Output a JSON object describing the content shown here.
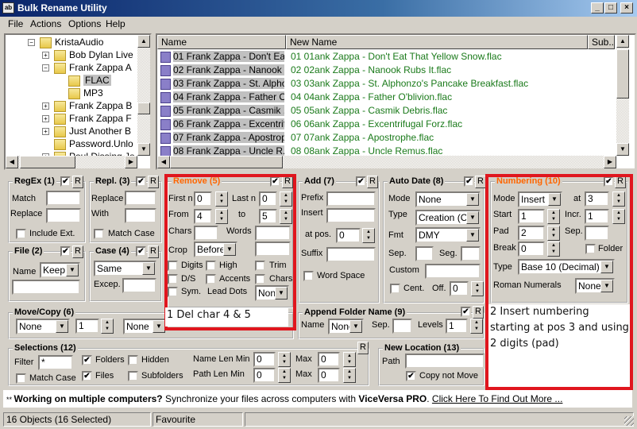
{
  "window": {
    "title": "Bulk Rename Utility",
    "icon": "app-icon"
  },
  "menu": [
    "File",
    "Actions",
    "Options",
    "Help"
  ],
  "tree": [
    {
      "label": "KristaAudio",
      "expander": "−",
      "indent": 0
    },
    {
      "label": "Bob Dylan Live",
      "expander": "+",
      "indent": 1
    },
    {
      "label": "Frank Zappa A",
      "expander": "−",
      "indent": 1
    },
    {
      "label": "FLAC",
      "expander": "",
      "indent": 2,
      "selected": true
    },
    {
      "label": "MP3",
      "expander": "",
      "indent": 2
    },
    {
      "label": "Frank Zappa B",
      "expander": "+",
      "indent": 1
    },
    {
      "label": "Frank Zappa F",
      "expander": "+",
      "indent": 1
    },
    {
      "label": "Just Another B",
      "expander": "+",
      "indent": 1
    },
    {
      "label": "Password.Unlo",
      "expander": "",
      "indent": 1
    },
    {
      "label": "Poul Dissing Jo",
      "expander": "+",
      "indent": 1
    }
  ],
  "filelist": {
    "columns": {
      "name": "Name",
      "new_name": "New Name",
      "sub": "Sub.."
    },
    "rows": [
      {
        "name": "01 Frank Zappa - Don't Eat...",
        "new_name": "01 01ank Zappa - Don't Eat That Yellow Snow.flac"
      },
      {
        "name": "02 Frank Zappa - Nanook ...",
        "new_name": "02 02ank Zappa - Nanook Rubs It.flac"
      },
      {
        "name": "03 Frank Zappa - St. Alpho...",
        "new_name": "03 03ank Zappa - St. Alphonzo's Pancake Breakfast.flac"
      },
      {
        "name": "04 Frank Zappa - Father O'...",
        "new_name": "04 04ank Zappa - Father O'blivion.flac"
      },
      {
        "name": "05 Frank Zappa - Casmik ...",
        "new_name": "05 05ank Zappa - Casmik Debris.flac"
      },
      {
        "name": "06 Frank Zappa - Excentrif...",
        "new_name": "06 06ank Zappa - Excentrifugal Forz.flac"
      },
      {
        "name": "07 Frank Zappa - Apostrop...",
        "new_name": "07 07ank Zappa - Apostrophe.flac"
      },
      {
        "name": "08 Frank Zappa - Uncle R...",
        "new_name": "08 08ank Zappa - Uncle Remus.flac"
      }
    ],
    "new_name_color": "#1a7a1a"
  },
  "regex": {
    "title": "RegEx (1)",
    "match": "Match",
    "replace": "Replace",
    "include_ext": "Include Ext.",
    "r": "R"
  },
  "repl": {
    "title": "Repl. (3)",
    "replace": "Replace",
    "with": "With",
    "match_case": "Match Case",
    "r": "R"
  },
  "remove": {
    "title": "Remove (5)",
    "title_color": "#ff6600",
    "first_n": "First n",
    "first_n_val": "0",
    "last_n": "Last n",
    "last_n_val": "0",
    "from": "From",
    "from_val": "4",
    "to": "to",
    "to_val": "5",
    "chars": "Chars",
    "words": "Words",
    "crop": "Crop",
    "crop_val": "Before",
    "digits": "Digits",
    "high": "High",
    "trim": "Trim",
    "ds": "D/S",
    "accents": "Accents",
    "chars2": "Chars",
    "sym": "Sym.",
    "lead_dots": "Lead Dots",
    "lead_dots_val": "None",
    "r": "R"
  },
  "file": {
    "title": "File (2)",
    "name": "Name",
    "name_val": "Keep",
    "r": "R"
  },
  "case": {
    "title": "Case (4)",
    "case_val": "Same",
    "excep": "Excep.",
    "r": "R"
  },
  "add": {
    "title": "Add (7)",
    "prefix": "Prefix",
    "insert": "Insert",
    "at_pos": "at pos.",
    "at_pos_val": "0",
    "suffix": "Suffix",
    "word_space": "Word Space",
    "r": "R"
  },
  "autodate": {
    "title": "Auto Date (8)",
    "mode": "Mode",
    "mode_val": "None",
    "type": "Type",
    "type_val": "Creation (Curr",
    "fmt": "Fmt",
    "fmt_val": "DMY",
    "sep": "Sep.",
    "seg": "Seg.",
    "custom": "Custom",
    "cent": "Cent.",
    "off": "Off.",
    "off_val": "0",
    "r": "R"
  },
  "numbering": {
    "title": "Numbering (10)",
    "title_color": "#ff6600",
    "mode": "Mode",
    "mode_val": "Insert",
    "at": "at",
    "at_val": "3",
    "start": "Start",
    "start_val": "1",
    "incr": "Incr.",
    "incr_val": "1",
    "pad": "Pad",
    "pad_val": "2",
    "sep": "Sep.",
    "brk": "Break",
    "break_val": "0",
    "folder": "Folder",
    "type": "Type",
    "type_val": "Base 10 (Decimal)",
    "roman": "Roman Numerals",
    "roman_val": "None",
    "r": "R"
  },
  "movecopy": {
    "title": "Move/Copy (6)",
    "mode_val": "None",
    "count_val": "1",
    "mode2_val": "None"
  },
  "appendfolder": {
    "title": "Append Folder Name (9)",
    "name": "Name",
    "name_val": "None",
    "sep": "Sep.",
    "levels": "Levels",
    "levels_val": "1",
    "r": "R"
  },
  "selections": {
    "title": "Selections (12)",
    "filter": "Filter",
    "filter_val": "*",
    "folders": "Folders",
    "hidden": "Hidden",
    "files": "Files",
    "subfolders": "Subfolders",
    "match_case": "Match Case",
    "name_len_min": "Name Len Min",
    "name_len_min_val": "0",
    "path_len_min": "Path Len Min",
    "path_len_min_val": "0",
    "max": "Max",
    "name_max_val": "0",
    "path_max_val": "0",
    "r": "R"
  },
  "newlocation": {
    "title": "New Location (13)",
    "path": "Path",
    "copy_not_move": "Copy not Move"
  },
  "annotations": {
    "remove_note": "1 Del char 4 & 5",
    "numbering_note": "2 Insert numbering starting at pos 3 and using 2 digits (pad)",
    "box_color": "#e0161e"
  },
  "promo": {
    "prefix": "** ",
    "bold": "Working on multiple computers?",
    "text": " Synchronize your files across computers with ",
    "product": "ViceVersa PRO",
    "dot": ". ",
    "link": "Click Here To Find Out More ..."
  },
  "status": {
    "objects": "16 Objects (16 Selected)",
    "favourite": "Favourite",
    "extra": ""
  }
}
